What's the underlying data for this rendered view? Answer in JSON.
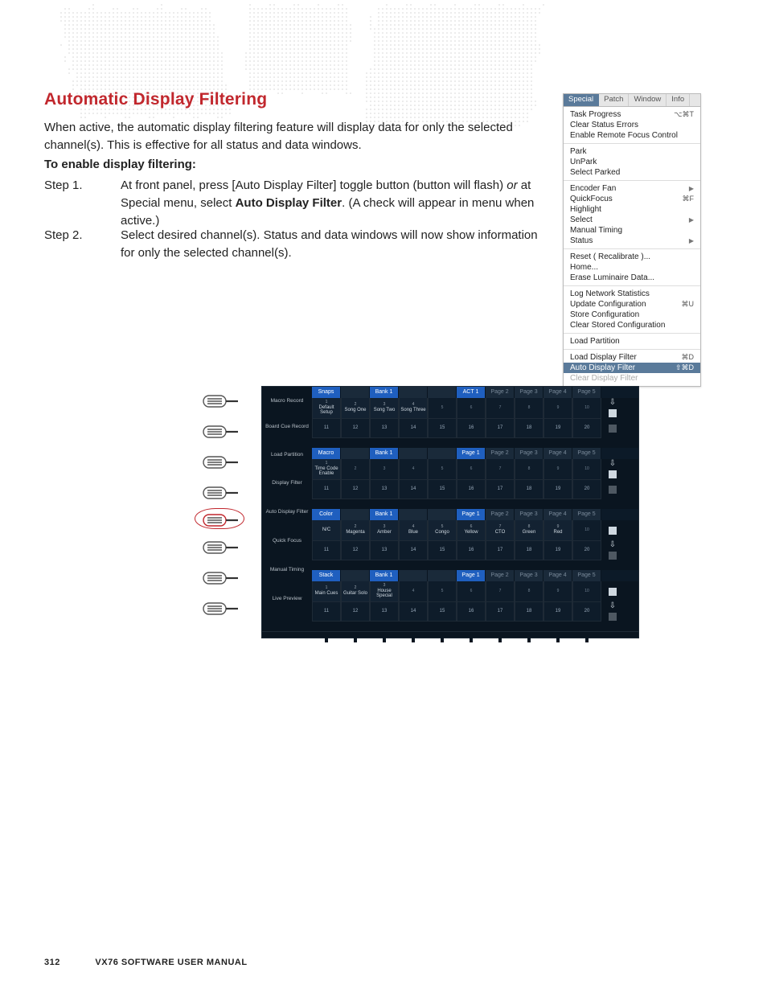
{
  "heading": "Automatic Display Filtering",
  "intro": "When active, the automatic display filtering feature will display data for only the selected channel(s). This is effective for all status and data windows.",
  "enable_label": "To enable display filtering:",
  "steps": {
    "s1_label": "Step    1.",
    "s1_body_a": "At front panel, press [Auto Display Filter] toggle button (button will flash) ",
    "s1_body_or": "or",
    "s1_body_b": " at Special menu, select ",
    "s1_body_bold": "Auto Display Filter",
    "s1_body_c": ". (A check will appear in menu when active.)",
    "s2_label": "Step    2.",
    "s2_body": "Select desired channel(s). Status and data windows will now show information for only the selected channel(s)."
  },
  "footer": {
    "page": "312",
    "title": "VX76 SOFTWARE USER MANUAL"
  },
  "menu": {
    "tabs": [
      "Special",
      "Patch",
      "Window",
      "Info"
    ],
    "tabs_active": 0,
    "groups": [
      [
        {
          "label": "Task Progress",
          "sc": "⌥⌘T"
        },
        {
          "label": "Clear Status Errors"
        },
        {
          "label": "Enable Remote Focus Control"
        }
      ],
      [
        {
          "label": "Park"
        },
        {
          "label": "UnPark"
        },
        {
          "label": "Select Parked"
        }
      ],
      [
        {
          "label": "Encoder Fan",
          "arrow": true
        },
        {
          "label": "QuickFocus",
          "sc": "⌘F"
        },
        {
          "label": "Highlight"
        },
        {
          "label": "Select",
          "arrow": true
        },
        {
          "label": "Manual Timing"
        },
        {
          "label": "Status",
          "arrow": true
        }
      ],
      [
        {
          "label": "Reset ( Recalibrate )..."
        },
        {
          "label": "Home..."
        },
        {
          "label": "Erase Luminaire Data..."
        }
      ],
      [
        {
          "label": "Log Network Statistics"
        },
        {
          "label": "Update Configuration",
          "sc": "⌘U"
        },
        {
          "label": "Store Configuration"
        },
        {
          "label": "Clear Stored Configuration"
        }
      ],
      [
        {
          "label": "Load Partition"
        }
      ],
      [
        {
          "label": "Load Display Filter",
          "sc": "⌘D"
        },
        {
          "label": "Auto Display Filter",
          "sc": "⇧⌘D",
          "sel": true
        },
        {
          "label": "Clear Display Filter",
          "dim": true
        }
      ]
    ]
  },
  "sidebtns": [
    "Macro Record",
    "Board Cue Record",
    "Load Partition",
    "Display Filter",
    "Auto Display Filter",
    "Quick Focus",
    "Manual Timing",
    "Live Preview"
  ],
  "panel": {
    "rows": [
      {
        "title": "Snaps",
        "bank": "Bank 1",
        "first": "ACT 1",
        "top": [
          {
            "n": "1",
            "l": "Default Setup"
          },
          {
            "n": "2",
            "l": "Song One"
          },
          {
            "n": "3",
            "l": "Song Two"
          },
          {
            "n": "4",
            "l": "Song Three"
          },
          {
            "n": "5"
          },
          {
            "n": "6"
          },
          {
            "n": "7"
          },
          {
            "n": "8"
          },
          {
            "n": "9"
          },
          {
            "n": "10"
          }
        ],
        "bot": [
          "11",
          "12",
          "13",
          "14",
          "15",
          "16",
          "17",
          "18",
          "19",
          "20"
        ]
      },
      {
        "title": "Macro",
        "bank": "Bank 1",
        "first": "Page 1",
        "top": [
          {
            "n": "1",
            "l": "Time Code Enable"
          },
          {
            "n": "2"
          },
          {
            "n": "3"
          },
          {
            "n": "4"
          },
          {
            "n": "5"
          },
          {
            "n": "6"
          },
          {
            "n": "7"
          },
          {
            "n": "8"
          },
          {
            "n": "9"
          },
          {
            "n": "10"
          }
        ],
        "bot": [
          "11",
          "12",
          "13",
          "14",
          "15",
          "16",
          "17",
          "18",
          "19",
          "20"
        ]
      },
      {
        "title": "Color",
        "bank": "Bank 1",
        "first": "Page 1",
        "top": [
          {
            "n": "",
            "l": "N/C"
          },
          {
            "n": "2",
            "l": "Magenta"
          },
          {
            "n": "3",
            "l": "Amber"
          },
          {
            "n": "4",
            "l": "Blue"
          },
          {
            "n": "5",
            "l": "Congo"
          },
          {
            "n": "6",
            "l": "Yellow"
          },
          {
            "n": "7",
            "l": "CTO"
          },
          {
            "n": "8",
            "l": "Green"
          },
          {
            "n": "9",
            "l": "Red"
          },
          {
            "n": "10"
          }
        ],
        "bot": [
          "11",
          "12",
          "13",
          "14",
          "15",
          "16",
          "17",
          "18",
          "19",
          "20"
        ]
      },
      {
        "title": "Stack",
        "bank": "Bank 1",
        "first": "Page 1",
        "top": [
          {
            "n": "1",
            "l": "Main Cues"
          },
          {
            "n": "2",
            "l": "Guitar Solo"
          },
          {
            "n": "3",
            "l": "House Special"
          },
          {
            "n": "4"
          },
          {
            "n": "5"
          },
          {
            "n": "6"
          },
          {
            "n": "7"
          },
          {
            "n": "8"
          },
          {
            "n": "9"
          },
          {
            "n": "10"
          }
        ],
        "bot": [
          "11",
          "12",
          "13",
          "14",
          "15",
          "16",
          "17",
          "18",
          "19",
          "20"
        ]
      }
    ],
    "pages": [
      "Page 2",
      "Page 3",
      "Page 4",
      "Page 5"
    ]
  }
}
